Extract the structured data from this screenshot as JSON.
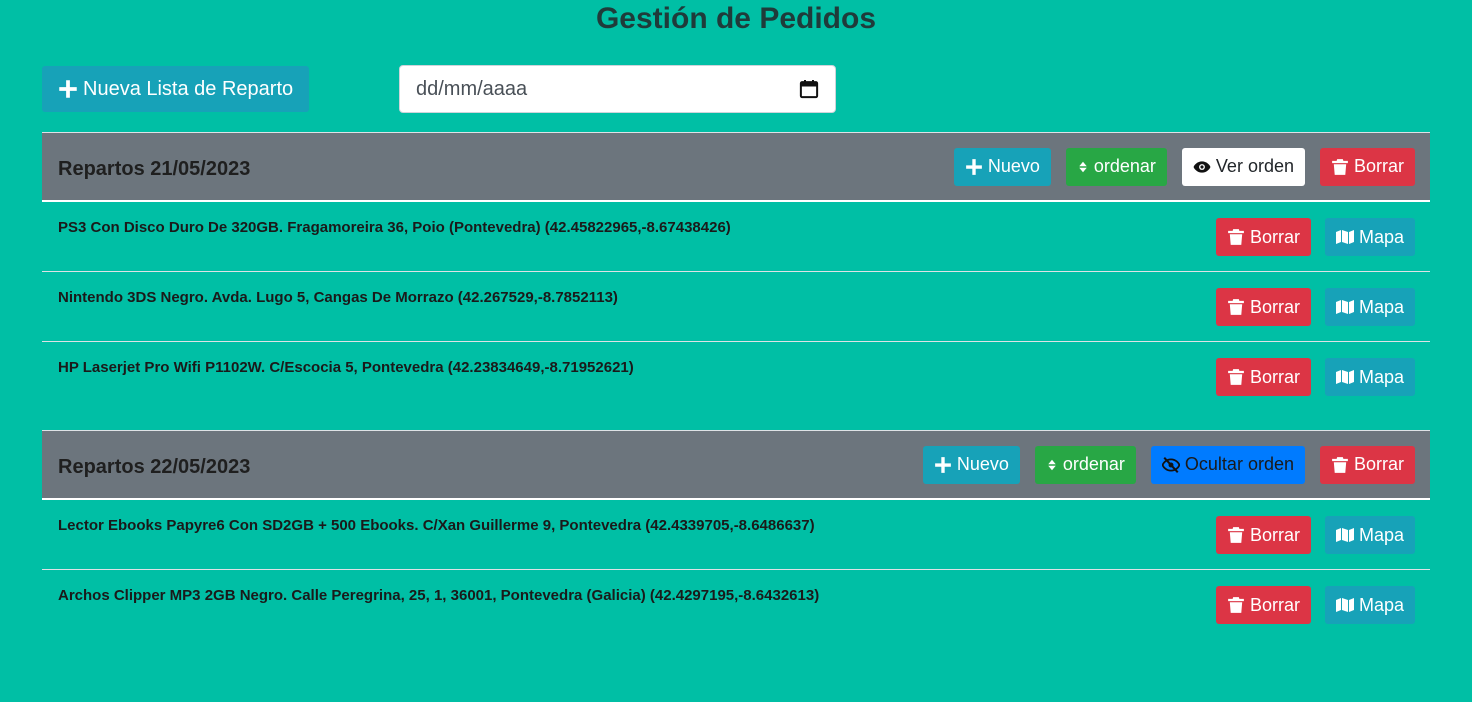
{
  "page": {
    "title": "Gestión de Pedidos"
  },
  "toolbar": {
    "new_list_label": "Nueva Lista de Reparto",
    "date_placeholder": "dd/mm/aaaa"
  },
  "groups": [
    {
      "title": "Repartos 21/05/2023",
      "actions": {
        "new": "Nuevo",
        "sort": "ordenar",
        "toggle": "Ver orden",
        "delete": "Borrar"
      },
      "items": [
        {
          "text": "PS3 Con Disco Duro De 320GB. Fragamoreira 36, Poio (Pontevedra) (42.45822965,-8.67438426)",
          "delete": "Borrar",
          "map": "Mapa"
        },
        {
          "text": "Nintendo 3DS Negro. Avda. Lugo 5, Cangas De Morrazo (42.267529,-8.7852113)",
          "delete": "Borrar",
          "map": "Mapa"
        },
        {
          "text": "HP Laserjet Pro Wifi P1102W. C/Escocia 5, Pontevedra (42.23834649,-8.71952621)",
          "delete": "Borrar",
          "map": "Mapa"
        }
      ]
    },
    {
      "title": "Repartos 22/05/2023",
      "actions": {
        "new": "Nuevo",
        "sort": "ordenar",
        "toggle": "Ocultar orden",
        "delete": "Borrar"
      },
      "items": [
        {
          "text": "Lector Ebooks Papyre6 Con SD2GB + 500 Ebooks. C/Xan Guillerme 9, Pontevedra (42.4339705,-8.6486637)",
          "delete": "Borrar",
          "map": "Mapa"
        },
        {
          "text": "Archos Clipper MP3 2GB Negro. Calle Peregrina, 25, 1, 36001, Pontevedra (Galicia) (42.4297195,-8.6432613)",
          "delete": "Borrar",
          "map": "Mapa"
        }
      ]
    }
  ],
  "colors": {
    "background": "#00bfa5",
    "header": "#6c757d",
    "info": "#17a2b8",
    "success": "#28a745",
    "danger": "#dc3545",
    "primary": "#007bff"
  }
}
